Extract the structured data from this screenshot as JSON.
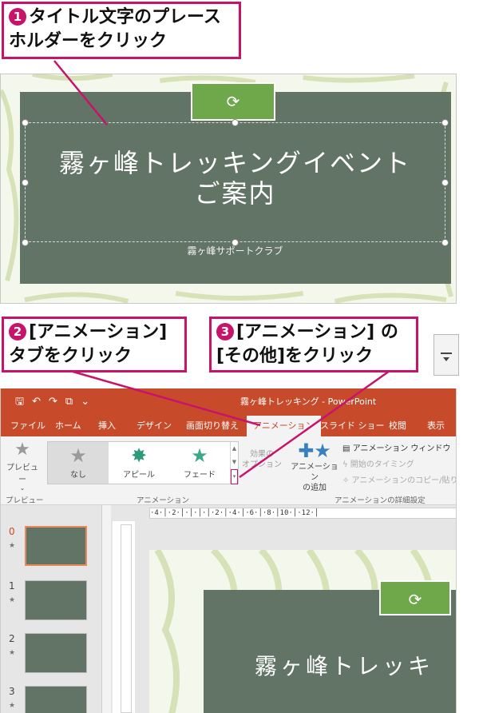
{
  "callouts": [
    {
      "num": "1",
      "line1": "タイトル文字のプレース",
      "line2": "ホルダーをクリック"
    },
    {
      "num": "2",
      "line1": "[アニメーション]",
      "line2": "タブをクリック"
    },
    {
      "num": "3",
      "line1": "[アニメーション] の",
      "line2": "[その他]をクリック"
    }
  ],
  "slide": {
    "title_line1": "霧ヶ峰トレッキングイベント",
    "title_line2": "ご案内",
    "subtitle": "霧ヶ峰サポートクラブ",
    "rotate_icon": "rotate-icon"
  },
  "window": {
    "title": "霧ヶ峰トレッキング - PowerPoint",
    "qat_icons": [
      "save-icon",
      "undo-icon",
      "redo-icon",
      "slideshow-icon",
      "customize-icon"
    ]
  },
  "tabs": [
    "ファイル",
    "ホーム",
    "挿入",
    "デザイン",
    "画面切り替え",
    "アニメーション",
    "スライド ショー",
    "校閲",
    "表示"
  ],
  "active_tab": "アニメーション",
  "ribbon": {
    "preview_label": "プレビュー",
    "preview_group": "プレビュー",
    "gallery": [
      {
        "label": "なし",
        "color": "#9a9a9a"
      },
      {
        "label": "アピール",
        "color": "#2e9a7a"
      },
      {
        "label": "フェード",
        "color": "#3aa889"
      }
    ],
    "effect_options_line1": "効果の",
    "effect_options_line2": "オプション",
    "animation_group": "アニメーション",
    "add_animation_line1": "アニメーション",
    "add_animation_line2": "の追加",
    "animation_window": "アニメーション ウィンドウ",
    "trigger": "開始のタイミング",
    "painter": "アニメーションのコピー/貼り付け",
    "advanced_group": "アニメーションの詳細設定"
  },
  "ruler_text": "·4·│·2·│·│·│·│·2·│·4·│·6·│·8·│10·│·12·│",
  "thumbnails": [
    {
      "num": "0",
      "current": true
    },
    {
      "num": "1",
      "current": false
    },
    {
      "num": "2",
      "current": false
    },
    {
      "num": "3",
      "current": false
    }
  ],
  "canvas_title": "霧ヶ峰トレッキ",
  "colors": {
    "accent": "#c8136b",
    "ppt_orange": "#c74b2a",
    "slide_green": "#627466",
    "tab_green": "#6fa84a"
  }
}
